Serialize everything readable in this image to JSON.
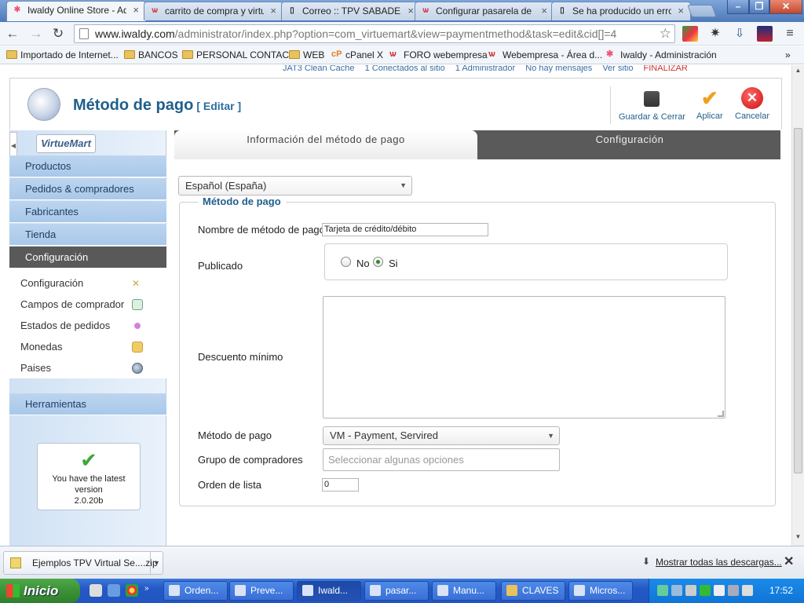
{
  "browser": {
    "tabs": [
      {
        "title": "Iwaldy Online Store - Adı",
        "active": true
      },
      {
        "title": "carrito de compra y virtu",
        "active": false
      },
      {
        "title": "Correo :: TPV SABADELL",
        "active": false
      },
      {
        "title": "Configurar pasarela de p",
        "active": false
      },
      {
        "title": "Se ha producido un error",
        "active": false
      }
    ],
    "url_domain": "www.iwaldy.com",
    "url_path": "/administrator/index.php?option=com_virtuemart&view=paymentmethod&task=edit&cid[]=4",
    "bookmarks": [
      "Importado de Internet...",
      "BANCOS",
      "PERSONAL CONTACT",
      "WEB",
      "cPanel X",
      "FORO webempresa",
      "Webempresa - Área d...",
      "Iwaldy - Administración"
    ]
  },
  "topstatus": [
    "JAT3 Clean Cache",
    "1 Conectados al sitio",
    "1 Administrador",
    "No hay mensajes",
    "Ver sitio",
    "FINALIZAR"
  ],
  "header": {
    "title": "Método de pago",
    "title_suffix": "[ Editar ]",
    "buttons": {
      "save_close": "Guardar & Cerrar",
      "apply": "Aplicar",
      "cancel": "Cancelar"
    }
  },
  "sidebar": {
    "logo": "VirtueMart",
    "menu": [
      "Productos",
      "Pedidos & compradores",
      "Fabricantes",
      "Tienda",
      "Configuración"
    ],
    "submenu": [
      "Configuración",
      "Campos de comprador",
      "Estados de pedidos",
      "Monedas",
      "Paises"
    ],
    "tools": "Herramientas",
    "version_text": "You have the latest version",
    "version_number": "2.0.20b"
  },
  "tabs": {
    "info": "Información del método de pago",
    "config": "Configuración"
  },
  "form": {
    "language": "Español (España)",
    "legend": "Método de pago",
    "name_label": "Nombre de método de pago",
    "name_value": "Tarjeta de crédito/débito",
    "published_label": "Publicado",
    "published_no": "No",
    "published_yes": "Si",
    "published_value": "Si",
    "discount_label": "Descuento mínimo",
    "method_label": "Método de pago",
    "method_value": "VM - Payment, Servired",
    "group_label": "Grupo de compradores",
    "group_placeholder": "Seleccionar algunas opciones",
    "order_label": "Orden de lista",
    "order_value": "0"
  },
  "downloads": {
    "item": "Ejemplos TPV Virtual Se....zip",
    "show_all": "Mostrar todas las descargas..."
  },
  "taskbar": {
    "start": "Inicio",
    "tasks": [
      "Orden...",
      "Preve...",
      "Iwald...",
      "pasar...",
      "Manu...",
      "CLAVES",
      "Micros..."
    ],
    "clock": "17:52"
  },
  "colors": {
    "accent": "#1f5f8b",
    "sidebar_active": "#595959",
    "tab_dark": "#5a5a5a"
  }
}
